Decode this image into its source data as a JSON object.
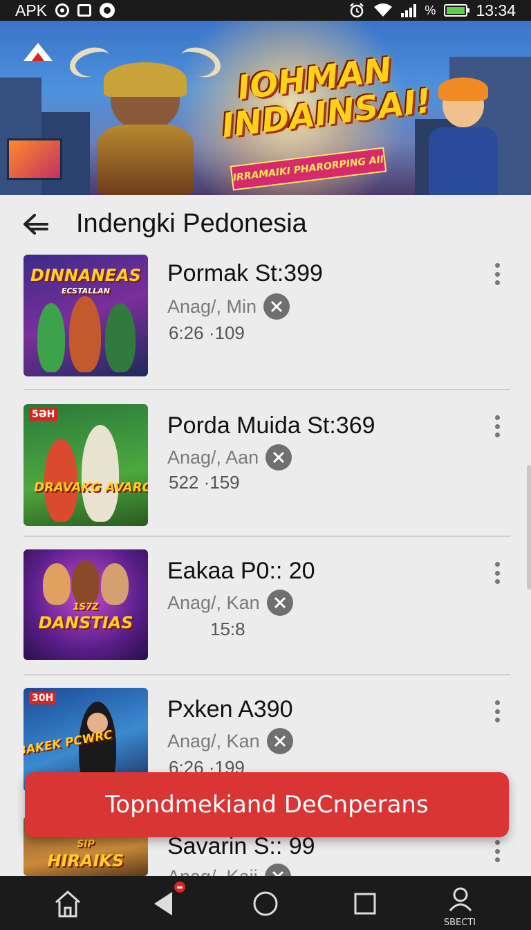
{
  "status_bar": {
    "carrier_label": "APK",
    "battery_percent_symbol": "%",
    "time": "13:34",
    "icons": [
      "sync-icon",
      "square-icon",
      "disc-icon",
      "alarm-icon",
      "wifi-icon",
      "signal-icon",
      "battery-icon"
    ]
  },
  "banner": {
    "title_line1": "IOHMAN",
    "title_line2": "INDAINSAI!",
    "subtitle": "IRRAMAIKI PHARORPING AII"
  },
  "header": {
    "title": "Indengki Pedonesia",
    "back_icon": "back-arrow-icon"
  },
  "list": [
    {
      "title": "Pormak St:399",
      "subtitle": "Anag/, Min",
      "meta": "6:26 ·109",
      "thumb_text": "DINNANEAS",
      "thumb_subtext": "ECSTALLAN",
      "thumb_tag": ""
    },
    {
      "title": "Porda Muida St:369",
      "subtitle": "Anag/, Aan",
      "meta": "522 ·159",
      "thumb_text": "DRAVAKG AVARC",
      "thumb_subtext": "",
      "thumb_tag": "5ƏH"
    },
    {
      "title": "Eakaa P0:: 20",
      "subtitle": "Anag/, Kan",
      "meta": "15:8",
      "thumb_text": "DANSTIAS",
      "thumb_subtext": "1S7Z",
      "thumb_tag": ""
    },
    {
      "title": "Pxken A390",
      "subtitle": "Anag/, Kan",
      "meta": "6:26 ·199",
      "thumb_text": "BAKEK PCWRC",
      "thumb_subtext": "",
      "thumb_tag": "30H"
    },
    {
      "title": "Savarin S:: 99",
      "subtitle": "Anag/, Kaji",
      "meta": "",
      "thumb_text": "HIRAIKS",
      "thumb_subtext": "SIP",
      "thumb_tag": ""
    }
  ],
  "cta": {
    "label": "Topndmekiand DeCnperans"
  },
  "nav_bar": {
    "items": [
      "home-icon",
      "back-triangle-icon",
      "home-circle-icon",
      "recents-square-icon",
      "profile-icon"
    ],
    "profile_label": "SBECTI"
  },
  "colors": {
    "accent_red": "#d93535",
    "bar_dark": "#1b1b1b",
    "page_bg": "#ececec"
  }
}
